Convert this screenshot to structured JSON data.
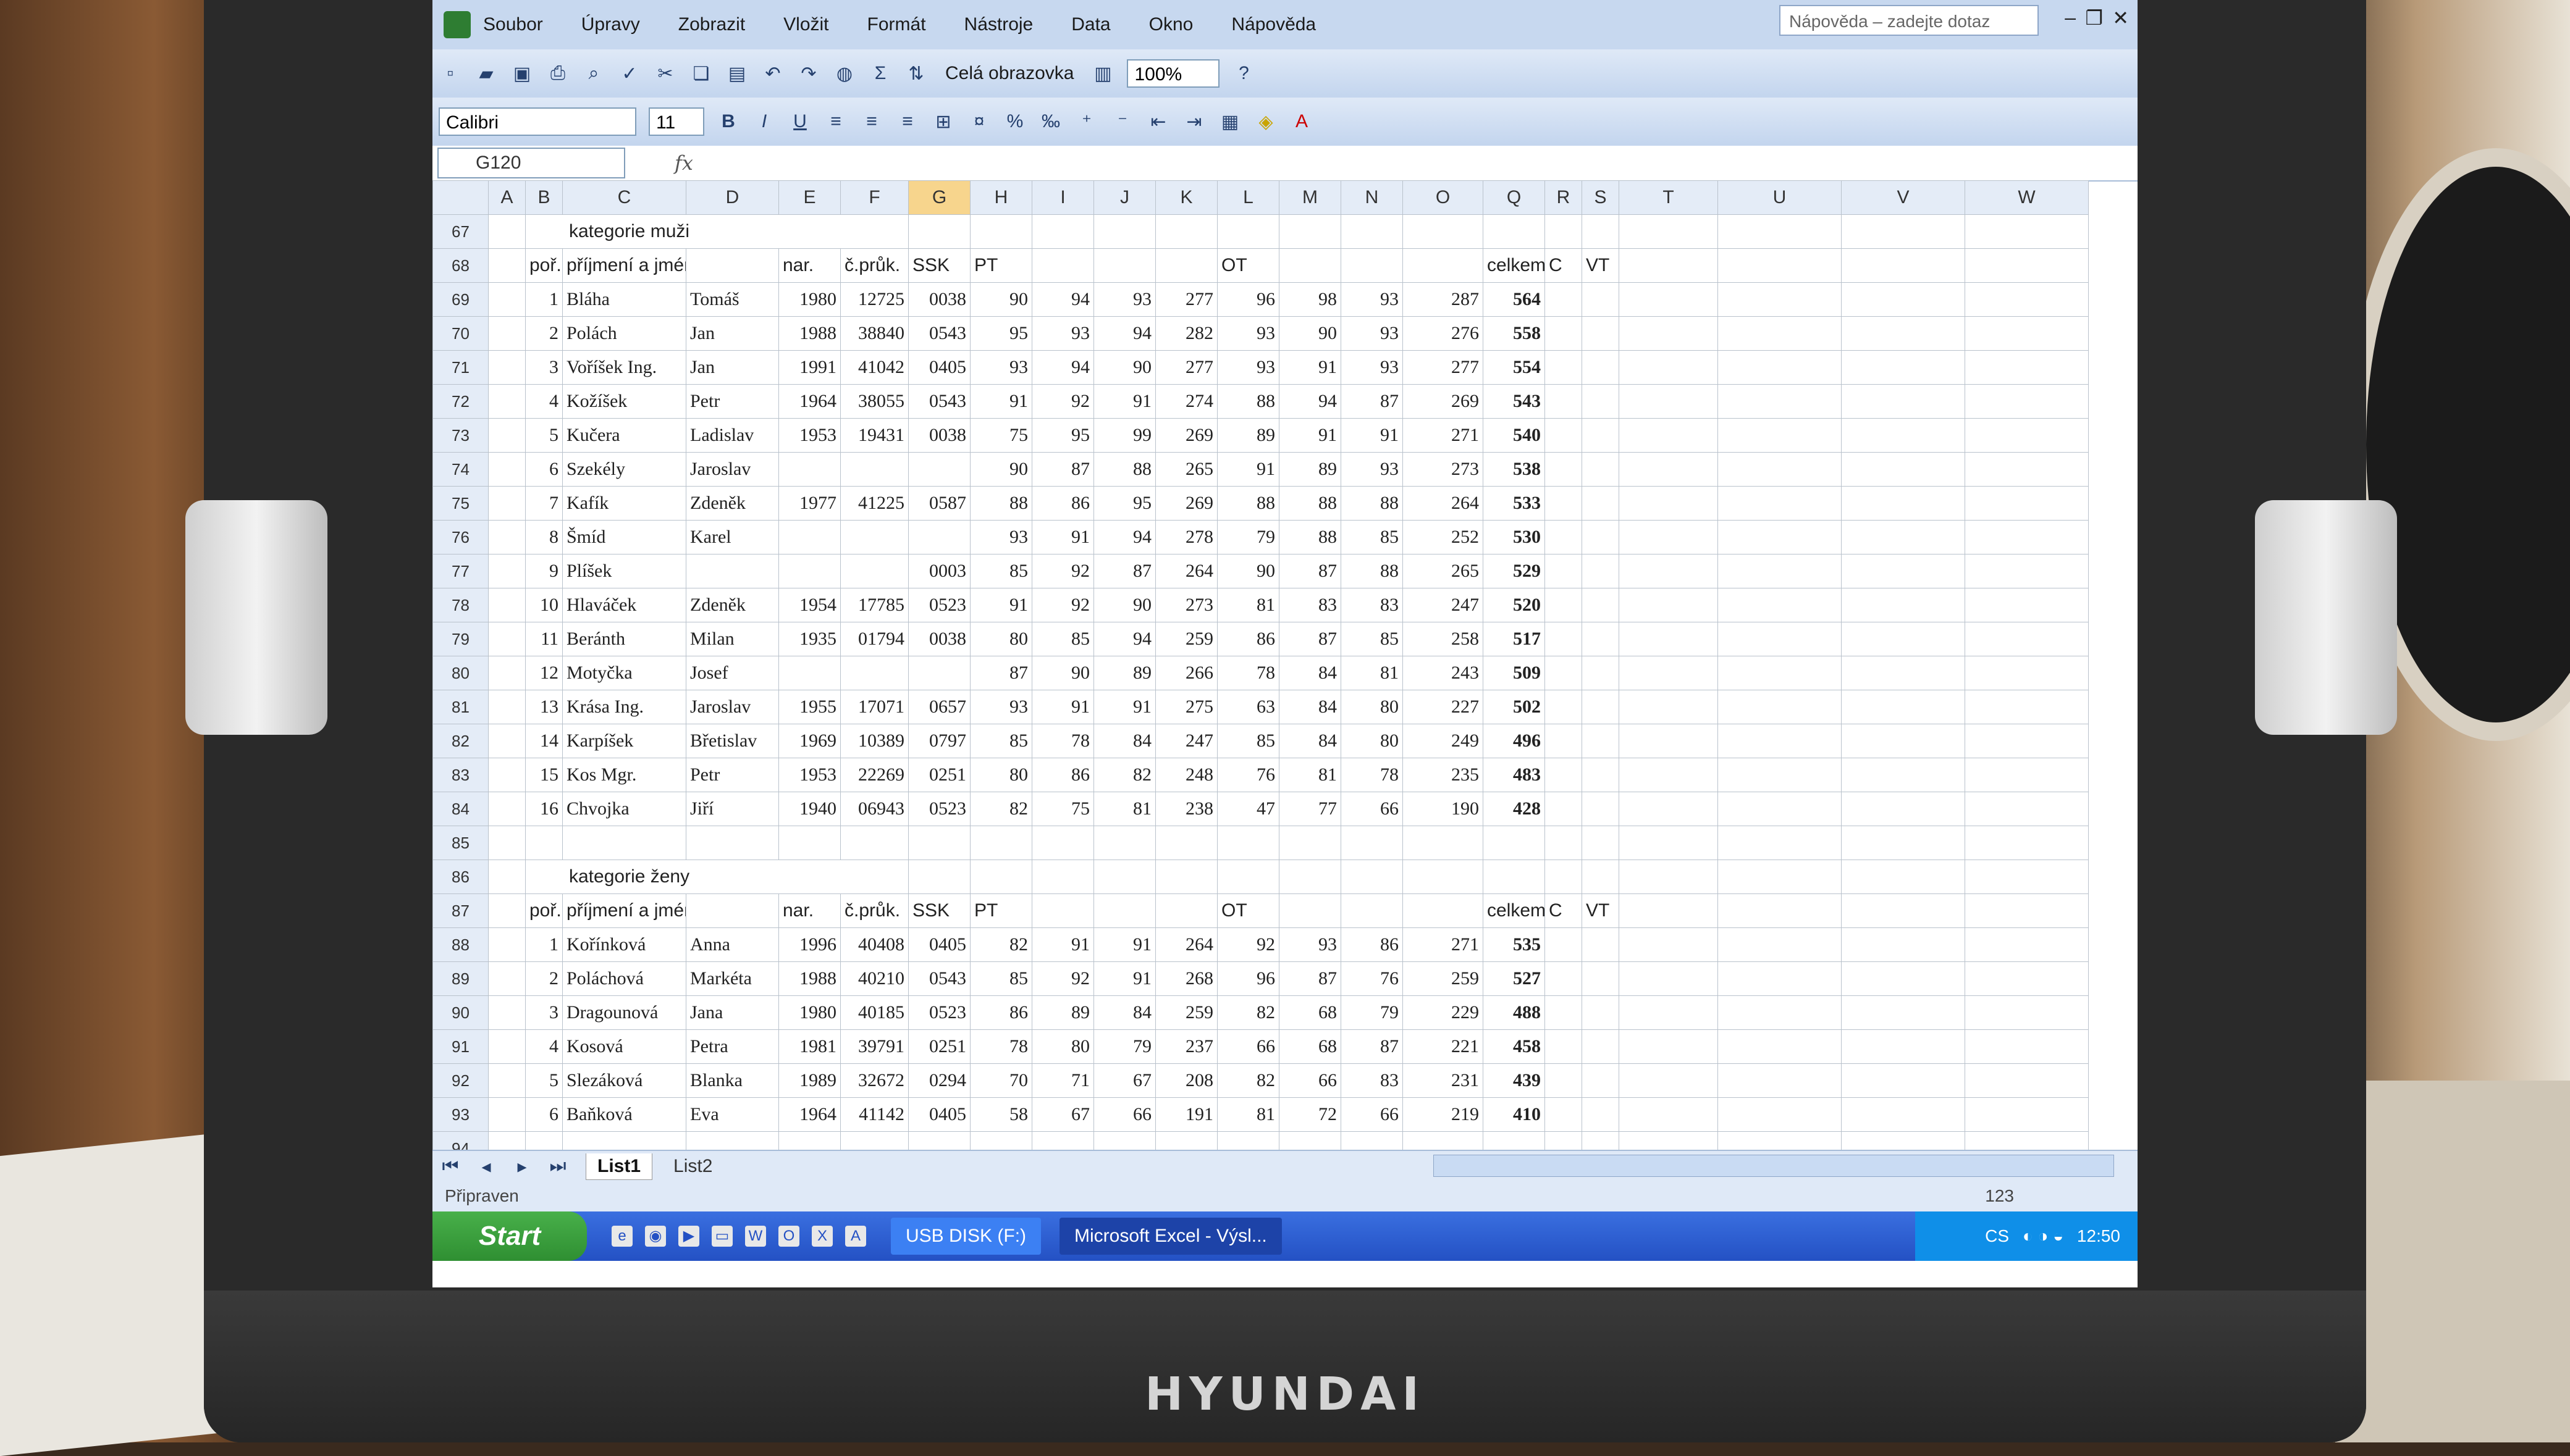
{
  "app": {
    "help_placeholder": "Nápověda – zadejte dotaz",
    "menus": [
      "Soubor",
      "Úpravy",
      "Zobrazit",
      "Vložit",
      "Formát",
      "Nástroje",
      "Data",
      "Okno",
      "Nápověda"
    ]
  },
  "toolbar": {
    "fullscreen_label": "Celá obrazovka",
    "zoom": "100%",
    "font_name": "Calibri",
    "font_size": "11"
  },
  "formula_bar": {
    "name_box": "G120",
    "fx": "fx"
  },
  "columns": [
    "A",
    "B",
    "C",
    "D",
    "E",
    "F",
    "G",
    "H",
    "I",
    "J",
    "K",
    "L",
    "M",
    "N",
    "O",
    "Q",
    "R",
    "S",
    "T",
    "U",
    "V",
    "W"
  ],
  "selected_column": "G",
  "rows": [
    {
      "r": "67",
      "section": "kategorie muži"
    },
    {
      "r": "68",
      "header": [
        "poř.",
        "příjmení a jméno",
        "",
        "nar.",
        "č.průk.",
        "SSK",
        "PT",
        "",
        "",
        "",
        "OT",
        "",
        "",
        "",
        "celkem",
        "C",
        "VT"
      ]
    },
    {
      "r": "69",
      "cells": [
        "1",
        "Bláha",
        "Tomáš",
        "1980",
        "12725",
        "0038",
        "90",
        "94",
        "93",
        "277",
        "96",
        "98",
        "93",
        "287",
        "564",
        "",
        ""
      ]
    },
    {
      "r": "70",
      "cells": [
        "2",
        "Polách",
        "Jan",
        "1988",
        "38840",
        "0543",
        "95",
        "93",
        "94",
        "282",
        "93",
        "90",
        "93",
        "276",
        "558",
        "",
        ""
      ]
    },
    {
      "r": "71",
      "cells": [
        "3",
        "Voříšek Ing.",
        "Jan",
        "1991",
        "41042",
        "0405",
        "93",
        "94",
        "90",
        "277",
        "93",
        "91",
        "93",
        "277",
        "554",
        "",
        ""
      ]
    },
    {
      "r": "72",
      "cells": [
        "4",
        "Kožíšek",
        "Petr",
        "1964",
        "38055",
        "0543",
        "91",
        "92",
        "91",
        "274",
        "88",
        "94",
        "87",
        "269",
        "543",
        "",
        ""
      ]
    },
    {
      "r": "73",
      "cells": [
        "5",
        "Kučera",
        "Ladislav",
        "1953",
        "19431",
        "0038",
        "75",
        "95",
        "99",
        "269",
        "89",
        "91",
        "91",
        "271",
        "540",
        "",
        ""
      ]
    },
    {
      "r": "74",
      "cells": [
        "6",
        "Szekély",
        "Jaroslav",
        "",
        "",
        "",
        "90",
        "87",
        "88",
        "265",
        "91",
        "89",
        "93",
        "273",
        "538",
        "",
        ""
      ]
    },
    {
      "r": "75",
      "cells": [
        "7",
        "Kafík",
        "Zdeněk",
        "1977",
        "41225",
        "0587",
        "88",
        "86",
        "95",
        "269",
        "88",
        "88",
        "88",
        "264",
        "533",
        "",
        ""
      ]
    },
    {
      "r": "76",
      "cells": [
        "8",
        "Šmíd",
        "Karel",
        "",
        "",
        "",
        "93",
        "91",
        "94",
        "278",
        "79",
        "88",
        "85",
        "252",
        "530",
        "",
        ""
      ]
    },
    {
      "r": "77",
      "cells": [
        "9",
        "Plíšek",
        "",
        "",
        "",
        "0003",
        "85",
        "92",
        "87",
        "264",
        "90",
        "87",
        "88",
        "265",
        "529",
        "",
        ""
      ]
    },
    {
      "r": "78",
      "cells": [
        "10",
        "Hlaváček",
        "Zdeněk",
        "1954",
        "17785",
        "0523",
        "91",
        "92",
        "90",
        "273",
        "81",
        "83",
        "83",
        "247",
        "520",
        "",
        ""
      ]
    },
    {
      "r": "79",
      "cells": [
        "11",
        "Beránth",
        "Milan",
        "1935",
        "01794",
        "0038",
        "80",
        "85",
        "94",
        "259",
        "86",
        "87",
        "85",
        "258",
        "517",
        "",
        ""
      ]
    },
    {
      "r": "80",
      "cells": [
        "12",
        "Motyčka",
        "Josef",
        "",
        "",
        "",
        "87",
        "90",
        "89",
        "266",
        "78",
        "84",
        "81",
        "243",
        "509",
        "",
        ""
      ]
    },
    {
      "r": "81",
      "cells": [
        "13",
        "Krása Ing.",
        "Jaroslav",
        "1955",
        "17071",
        "0657",
        "93",
        "91",
        "91",
        "275",
        "63",
        "84",
        "80",
        "227",
        "502",
        "",
        ""
      ]
    },
    {
      "r": "82",
      "cells": [
        "14",
        "Karpíšek",
        "Břetislav",
        "1969",
        "10389",
        "0797",
        "85",
        "78",
        "84",
        "247",
        "85",
        "84",
        "80",
        "249",
        "496",
        "",
        ""
      ]
    },
    {
      "r": "83",
      "cells": [
        "15",
        "Kos Mgr.",
        "Petr",
        "1953",
        "22269",
        "0251",
        "80",
        "86",
        "82",
        "248",
        "76",
        "81",
        "78",
        "235",
        "483",
        "",
        ""
      ]
    },
    {
      "r": "84",
      "cells": [
        "16",
        "Chvojka",
        "Jiří",
        "1940",
        "06943",
        "0523",
        "82",
        "75",
        "81",
        "238",
        "47",
        "77",
        "66",
        "190",
        "428",
        "",
        ""
      ]
    },
    {
      "r": "85"
    },
    {
      "r": "86",
      "section": "kategorie ženy"
    },
    {
      "r": "87",
      "header": [
        "poř.",
        "příjmení a jméno",
        "",
        "nar.",
        "č.průk.",
        "SSK",
        "PT",
        "",
        "",
        "",
        "OT",
        "",
        "",
        "",
        "celkem",
        "C",
        "VT"
      ]
    },
    {
      "r": "88",
      "cells": [
        "1",
        "Kořínková",
        "Anna",
        "1996",
        "40408",
        "0405",
        "82",
        "91",
        "91",
        "264",
        "92",
        "93",
        "86",
        "271",
        "535",
        "",
        ""
      ]
    },
    {
      "r": "89",
      "cells": [
        "2",
        "Poláchová",
        "Markéta",
        "1988",
        "40210",
        "0543",
        "85",
        "92",
        "91",
        "268",
        "96",
        "87",
        "76",
        "259",
        "527",
        "",
        ""
      ]
    },
    {
      "r": "90",
      "cells": [
        "3",
        "Dragounová",
        "Jana",
        "1980",
        "40185",
        "0523",
        "86",
        "89",
        "84",
        "259",
        "82",
        "68",
        "79",
        "229",
        "488",
        "",
        ""
      ]
    },
    {
      "r": "91",
      "cells": [
        "4",
        "Kosová",
        "Petra",
        "1981",
        "39791",
        "0251",
        "78",
        "80",
        "79",
        "237",
        "66",
        "68",
        "87",
        "221",
        "458",
        "",
        ""
      ]
    },
    {
      "r": "92",
      "cells": [
        "5",
        "Slezáková",
        "Blanka",
        "1989",
        "32672",
        "0294",
        "70",
        "71",
        "67",
        "208",
        "82",
        "66",
        "83",
        "231",
        "439",
        "",
        ""
      ]
    },
    {
      "r": "93",
      "cells": [
        "6",
        "Baňková",
        "Eva",
        "1964",
        "41142",
        "0405",
        "58",
        "67",
        "66",
        "191",
        "81",
        "72",
        "66",
        "219",
        "410",
        "",
        ""
      ]
    },
    {
      "r": "94"
    }
  ],
  "sheets": [
    "List1",
    "List2"
  ],
  "active_sheet": "List1",
  "status": {
    "ready": "Připraven",
    "num": "123"
  },
  "taskbar": {
    "start": "Start",
    "tasks": [
      "USB DISK (F:)",
      "Microsoft Excel - Výsl..."
    ],
    "active_task": 1,
    "lang": "CS",
    "clock": "12:50"
  },
  "monitor_brand": "HYUNDAI",
  "colors": {
    "selected_col": "#f7d58d",
    "taskbar": "#2451c4",
    "start": "#3a9d3c"
  }
}
